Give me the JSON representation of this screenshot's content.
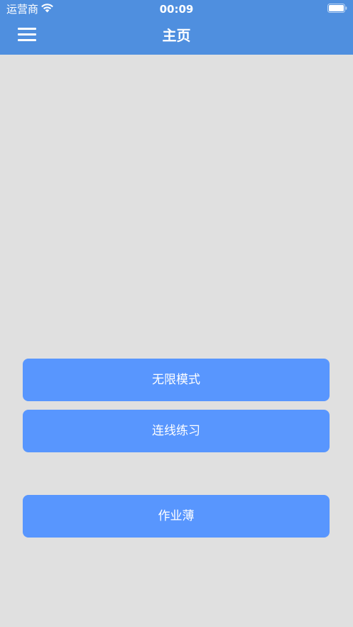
{
  "status_bar": {
    "carrier": "运营商",
    "time": "00:09",
    "icons": [
      "wifi-icon",
      "battery-icon"
    ]
  },
  "nav_bar": {
    "title": "主页",
    "menu_icon": "menu-icon"
  },
  "buttons": {
    "endless_mode": "无限模式",
    "matching_practice": "连线练习",
    "workbook": "作业薄"
  },
  "colors": {
    "header_bg": "#4f8fdf",
    "button_bg": "#5896fe",
    "page_bg": "#e0e0e0",
    "text_light": "#ffffff"
  }
}
